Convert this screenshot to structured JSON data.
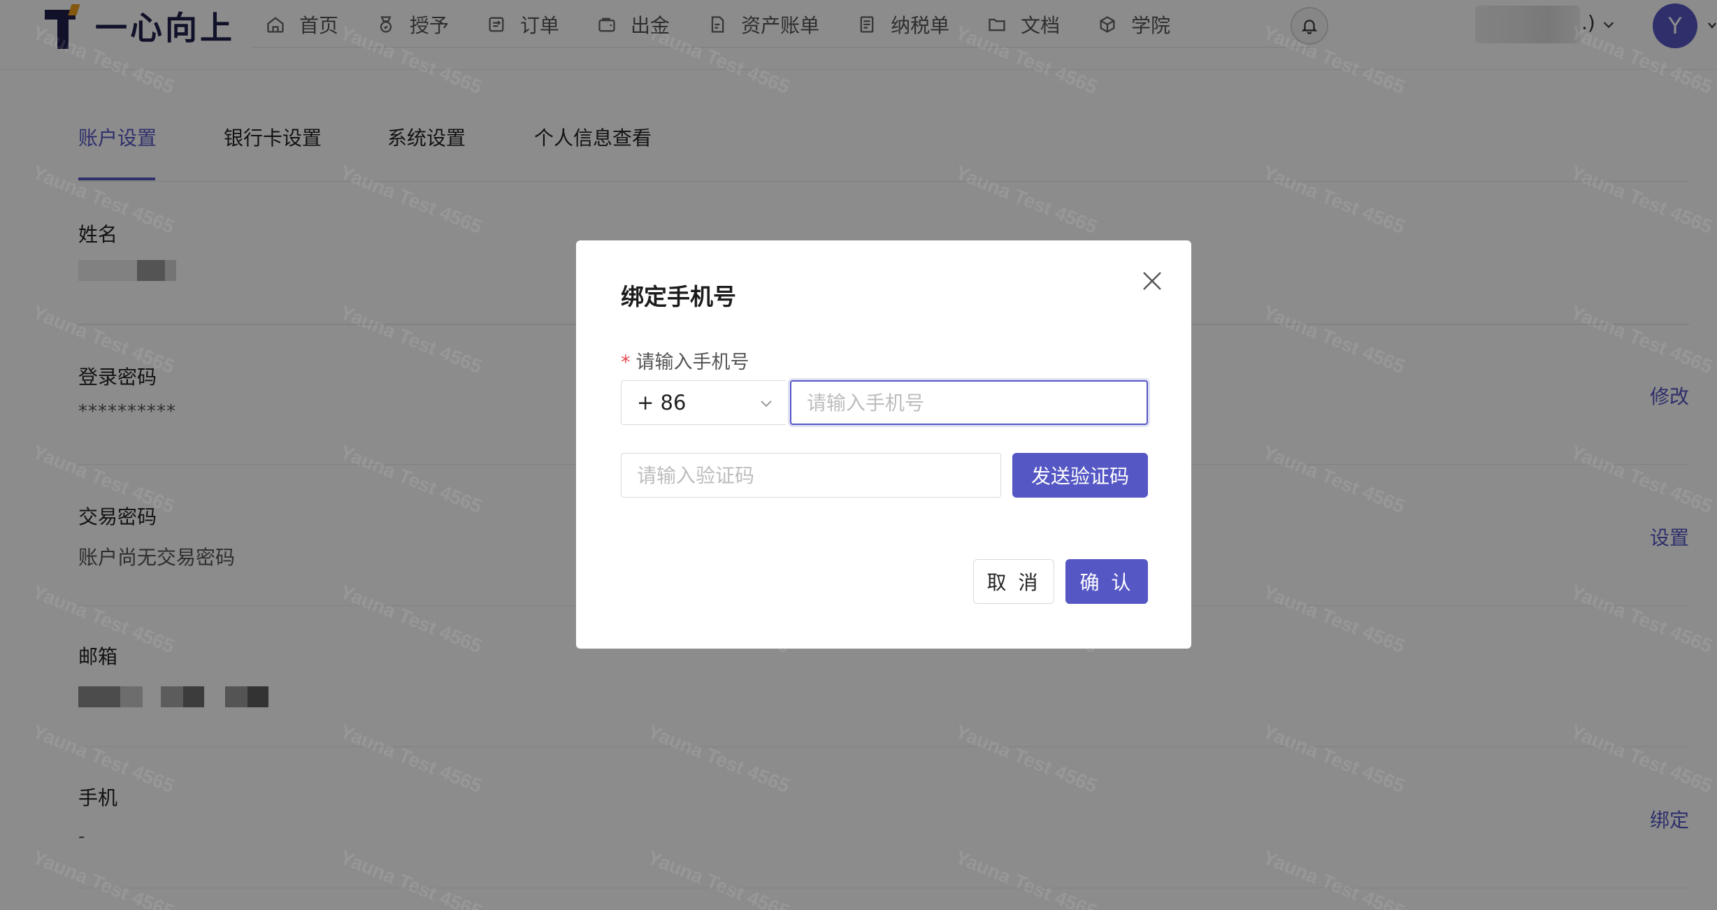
{
  "brand": {
    "name": "一心向上",
    "primary_color": "#5557c4",
    "dark_color": "#1f1f4e",
    "accent_color": "#f0a01c"
  },
  "nav": {
    "items": [
      {
        "label": "首页",
        "icon": "home-icon"
      },
      {
        "label": "授予",
        "icon": "medal-icon"
      },
      {
        "label": "订单",
        "icon": "order-icon"
      },
      {
        "label": "出金",
        "icon": "wallet-icon"
      },
      {
        "label": "资产账单",
        "icon": "document-icon"
      },
      {
        "label": "纳税单",
        "icon": "tax-icon"
      },
      {
        "label": "文档",
        "icon": "folder-icon"
      },
      {
        "label": "学院",
        "icon": "cube-icon"
      }
    ]
  },
  "user": {
    "name_suffix": ".)",
    "avatar_initial": "Y"
  },
  "tabs": [
    {
      "label": "账户设置",
      "active": true
    },
    {
      "label": "银行卡设置",
      "active": false
    },
    {
      "label": "系统设置",
      "active": false
    },
    {
      "label": "个人信息查看",
      "active": false
    }
  ],
  "settings": {
    "name": {
      "label": "姓名"
    },
    "login_password": {
      "label": "登录密码",
      "value": "**********",
      "action": "修改"
    },
    "trade_password": {
      "label": "交易密码",
      "value": "账户尚无交易密码",
      "action": "设置"
    },
    "email": {
      "label": "邮箱"
    },
    "phone": {
      "label": "手机",
      "value": "-",
      "action": "绑定"
    }
  },
  "modal": {
    "title": "绑定手机号",
    "phone_label": "请输入手机号",
    "required_mark": "*",
    "country_code": "+ 86",
    "phone_placeholder": "请输入手机号",
    "code_placeholder": "请输入验证码",
    "send_code": "发送验证码",
    "cancel": "取 消",
    "confirm": "确 认"
  },
  "watermark": "Yauna Test 4565"
}
